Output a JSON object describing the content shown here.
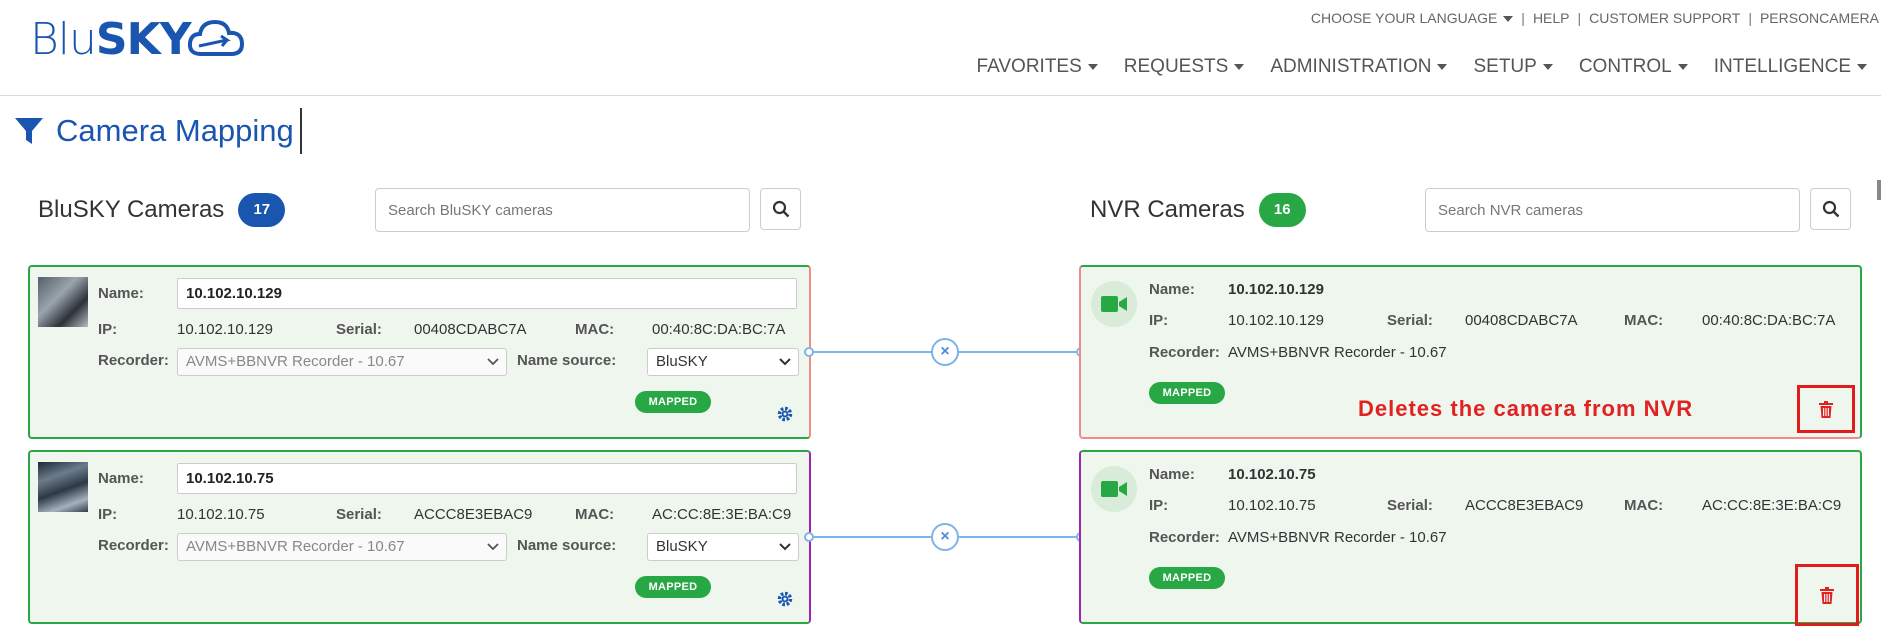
{
  "brand": {
    "blu": "Blu",
    "sky": "SKY",
    "accent": "#1a56b0"
  },
  "topbar": {
    "language": "CHOOSE YOUR LANGUAGE",
    "help": "HELP",
    "support": "CUSTOMER SUPPORT",
    "person": "PERSONCAMERA"
  },
  "nav": [
    "FAVORITES",
    "REQUESTS",
    "ADMINISTRATION",
    "SETUP",
    "CONTROL",
    "INTELLIGENCE"
  ],
  "page": {
    "title": "Camera Mapping"
  },
  "bluesky": {
    "label": "BluSKY Cameras",
    "count": "17",
    "search_placeholder": "Search BluSKY cameras"
  },
  "nvr": {
    "label": "NVR Cameras",
    "count": "16",
    "search_placeholder": "Search NVR cameras"
  },
  "labels": {
    "name": "Name:",
    "ip": "IP:",
    "serial": "Serial:",
    "mac": "MAC:",
    "recorder": "Recorder:",
    "name_source": "Name source:",
    "mapped": "MAPPED"
  },
  "blu_cameras": [
    {
      "name": "10.102.10.129",
      "ip": "10.102.10.129",
      "serial": "00408CDABC7A",
      "mac": "00:40:8C:DA:BC:7A",
      "recorder": "AVMS+BBNVR Recorder - 10.67",
      "name_source": "BluSKY",
      "status": "MAPPED"
    },
    {
      "name": "10.102.10.75",
      "ip": "10.102.10.75",
      "serial": "ACCC8E3EBAC9",
      "mac": "AC:CC:8E:3E:BA:C9",
      "recorder": "AVMS+BBNVR Recorder - 10.67",
      "name_source": "BluSKY",
      "status": "MAPPED"
    }
  ],
  "nvr_cameras": [
    {
      "name": "10.102.10.129",
      "ip": "10.102.10.129",
      "serial": "00408CDABC7A",
      "mac": "00:40:8C:DA:BC:7A",
      "recorder": "AVMS+BBNVR Recorder - 10.67",
      "status": "MAPPED"
    },
    {
      "name": "10.102.10.75",
      "ip": "10.102.10.75",
      "serial": "ACCC8E3EBAC9",
      "mac": "AC:CC:8E:3E:BA:C9",
      "recorder": "AVMS+BBNVR Recorder - 10.67",
      "status": "MAPPED"
    }
  ],
  "annotation": {
    "text": "Deletes the camera from NVR",
    "color": "#e02222"
  },
  "icons": {
    "filter": "filter-icon",
    "search": "search-icon",
    "gear": "gear-icon",
    "camera": "video-camera-icon",
    "trash": "trash-icon",
    "unlink": "close-icon"
  }
}
